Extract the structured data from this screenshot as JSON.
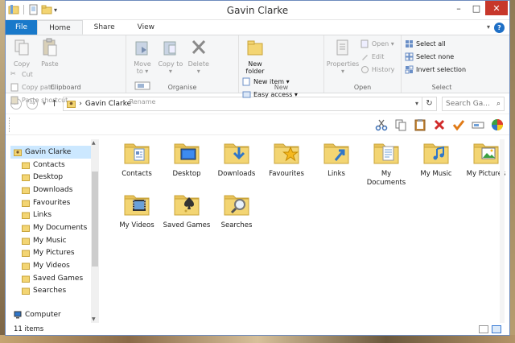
{
  "window": {
    "title": "Gavin Clarke"
  },
  "titlebar": {
    "minimize": "–",
    "maximize": "□",
    "close": "✕",
    "qat_dropdown": "▾"
  },
  "tabs": [
    {
      "label": "File"
    },
    {
      "label": "Home"
    },
    {
      "label": "Share"
    },
    {
      "label": "View"
    }
  ],
  "help": "?",
  "ribbon": {
    "clipboard": {
      "copy": "Copy",
      "paste": "Paste",
      "cut": "Cut",
      "copy_path": "Copy path",
      "paste_shortcut": "Paste shortcut",
      "label": "Clipboard"
    },
    "organise": {
      "move_to": "Move to ▾",
      "copy_to": "Copy to ▾",
      "delete": "Delete ▾",
      "rename": "Rename",
      "label": "Organise"
    },
    "new": {
      "new_folder": "New folder",
      "new_item": "New item ▾",
      "easy_access": "Easy access ▾",
      "label": "New"
    },
    "open": {
      "properties": "Properties ▾",
      "open": "Open ▾",
      "edit": "Edit",
      "history": "History",
      "label": "Open"
    },
    "select": {
      "select_all": "Select all",
      "select_none": "Select none",
      "invert_selection": "Invert selection",
      "label": "Select"
    }
  },
  "address": {
    "back": "←",
    "forward": "→",
    "recent": "▾",
    "up": "↑",
    "separator": "›",
    "path": "Gavin Clarke",
    "dropdown": "▾",
    "refresh": "↻",
    "search_placeholder": "Search Ga...",
    "search_icon": "⌕"
  },
  "nav": {
    "items": [
      {
        "label": "Gavin Clarke",
        "icon": "user-folder-icon"
      },
      {
        "label": "Contacts"
      },
      {
        "label": "Desktop"
      },
      {
        "label": "Downloads"
      },
      {
        "label": "Favourites"
      },
      {
        "label": "Links"
      },
      {
        "label": "My Documents"
      },
      {
        "label": "My Music"
      },
      {
        "label": "My Pictures"
      },
      {
        "label": "My Videos"
      },
      {
        "label": "Saved Games"
      },
      {
        "label": "Searches"
      }
    ],
    "computer": "Computer",
    "expand_glyph": "▸",
    "scroll_up": "▲",
    "scroll_down": "▼"
  },
  "files": [
    {
      "label": "Contacts",
      "overlay": "contacts"
    },
    {
      "label": "Desktop",
      "overlay": "desktop"
    },
    {
      "label": "Downloads",
      "overlay": "downloads"
    },
    {
      "label": "Favourites",
      "overlay": "star"
    },
    {
      "label": "Links",
      "overlay": "links"
    },
    {
      "label": "My Documents",
      "overlay": "documents"
    },
    {
      "label": "My Music",
      "overlay": "music"
    },
    {
      "label": "My Pictures",
      "overlay": "pictures"
    },
    {
      "label": "My Videos",
      "overlay": "videos"
    },
    {
      "label": "Saved Games",
      "overlay": "games"
    },
    {
      "label": "Searches",
      "overlay": "search"
    }
  ],
  "status": {
    "items_count": "11 items"
  },
  "colors": {
    "file_tab": "#1979ca",
    "close_button": "#c7372b",
    "folder": "#f3d573",
    "selection": "#cce8ff"
  }
}
